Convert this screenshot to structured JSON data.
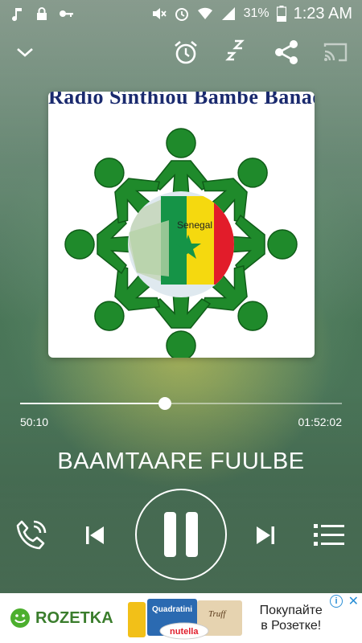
{
  "status_bar": {
    "battery_percent": "31%",
    "time": "1:23 AM",
    "icons_left": [
      "music-note-icon",
      "lock-icon",
      "key-icon"
    ],
    "icons_right": [
      "mute-icon",
      "alarm-icon",
      "wifi-icon",
      "signal-icon",
      "battery-icon"
    ]
  },
  "top_controls": {
    "icons": [
      "chevron-down-icon",
      "alarm-clock-icon",
      "sleep-timer-icon",
      "share-icon",
      "cast-icon"
    ]
  },
  "album_art": {
    "title_text": "Radio Sinthiou Bambé Banadji",
    "map_label": "Senegal"
  },
  "player": {
    "elapsed": "50:10",
    "duration": "01:52:02",
    "progress_fraction": 0.45,
    "track_title": "BAAMTAARE FUULBE"
  },
  "controls": {
    "icons": [
      "phone-icon",
      "previous-icon",
      "pause-icon",
      "next-icon",
      "playlist-icon"
    ]
  },
  "ad": {
    "brand": "ROZETKA",
    "product_labels": [
      "Quadratini",
      "Truff",
      "nutella"
    ],
    "text_line1": "Покупайте",
    "text_line2": "в Розетке!",
    "info_label": "i",
    "close_label": "✕",
    "accent": "#3a7d2c"
  },
  "colors": {
    "background": "#4d7b5c",
    "figure_green": "#1f8a2b",
    "flag_green": "#159447",
    "flag_yellow": "#f5d90f",
    "flag_red": "#e21c2a"
  }
}
